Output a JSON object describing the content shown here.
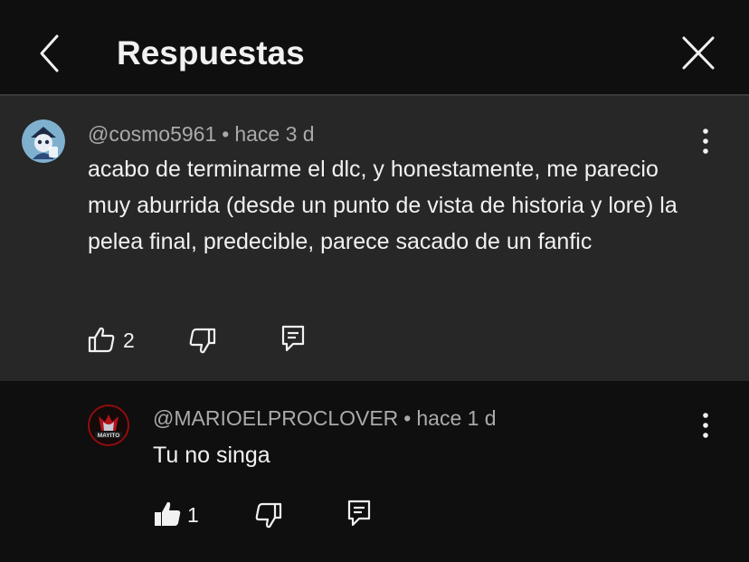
{
  "header": {
    "title": "Respuestas"
  },
  "parent": {
    "author": "@cosmo5961",
    "separator": "•",
    "time": "hace 3 d",
    "text": "acabo de terminarme el dlc, y honestamente, me parecio muy aburrida (desde un punto de vista de historia y lore) la pelea final, predecible, parece sacado de un fanfic",
    "likes": "2"
  },
  "reply": {
    "author": "@MARIOELPROCLOVER",
    "separator": "•",
    "time": "hace 1 d",
    "text": "Tu no singa",
    "likes": "1",
    "avatar_label": "MAYITO"
  },
  "colors": {
    "background": "#0f0f0f",
    "highlight": "#272727",
    "secondary_text": "#aaaaaa",
    "primary_text": "#f1f1f1"
  },
  "icons": [
    "chevron-left-icon",
    "close-icon",
    "more-vert-icon",
    "thumb-up-icon",
    "thumb-down-icon",
    "reply-comment-icon"
  ]
}
